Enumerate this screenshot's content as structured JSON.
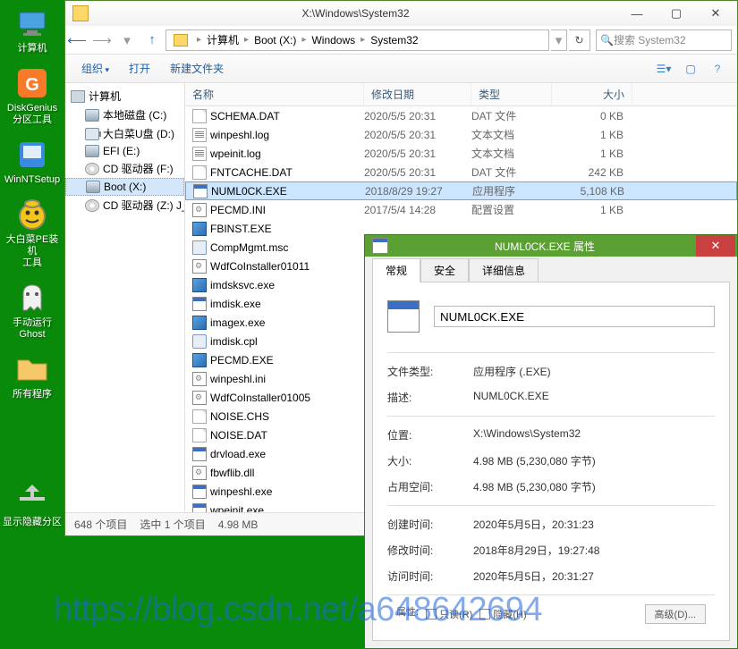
{
  "desktop": {
    "icons": [
      {
        "name": "computer",
        "label": "计算机",
        "color": "#4aa3e0"
      },
      {
        "name": "diskgenius",
        "label": "DiskGenius\n分区工具",
        "color": "#f77a2a"
      },
      {
        "name": "winntsetup",
        "label": "WinNTSetup",
        "color": "#3a8ae0"
      },
      {
        "name": "pe-tool",
        "label": "大白菜PE装机\n工具",
        "color": "#f5c51a"
      },
      {
        "name": "ghost",
        "label": "手动运行\nGhost",
        "color": "#e8e8e8"
      },
      {
        "name": "programs",
        "label": "所有程序",
        "color": "#f5c86a"
      },
      {
        "name": "hide-partition",
        "label": "显示隐藏分区",
        "color": "#888"
      }
    ]
  },
  "explorer": {
    "title": "X:\\Windows\\System32",
    "breadcrumbs": [
      "计算机",
      "Boot (X:)",
      "Windows",
      "System32"
    ],
    "search_placeholder": "搜索 System32",
    "commands": {
      "organize": "组织",
      "open": "打开",
      "new_folder": "新建文件夹"
    },
    "tree": [
      {
        "icon": "pc",
        "label": "计算机",
        "indent": 0
      },
      {
        "icon": "drive",
        "label": "本地磁盘 (C:)",
        "indent": 1
      },
      {
        "icon": "usb",
        "label": "大白菜U盘 (D:)",
        "indent": 1
      },
      {
        "icon": "drive",
        "label": "EFI (E:)",
        "indent": 1
      },
      {
        "icon": "cd",
        "label": "CD 驱动器 (F:)",
        "indent": 1
      },
      {
        "icon": "drive",
        "label": "Boot (X:)",
        "indent": 1,
        "sel": true
      },
      {
        "icon": "cd",
        "label": "CD 驱动器 (Z:) J_CC",
        "indent": 1
      }
    ],
    "columns": {
      "name": "名称",
      "date": "修改日期",
      "type": "类型",
      "size": "大小"
    },
    "files": [
      {
        "ico": "file",
        "name": "SCHEMA.DAT",
        "date": "2020/5/5 20:31",
        "type": "DAT 文件",
        "size": "0 KB"
      },
      {
        "ico": "txt",
        "name": "winpeshl.log",
        "date": "2020/5/5 20:31",
        "type": "文本文档",
        "size": "1 KB"
      },
      {
        "ico": "txt",
        "name": "wpeinit.log",
        "date": "2020/5/5 20:31",
        "type": "文本文档",
        "size": "1 KB"
      },
      {
        "ico": "file",
        "name": "FNTCACHE.DAT",
        "date": "2020/5/5 20:31",
        "type": "DAT 文件",
        "size": "242 KB"
      },
      {
        "ico": "exe",
        "name": "NUML0CK.EXE",
        "date": "2018/8/29 19:27",
        "type": "应用程序",
        "size": "5,108 KB",
        "sel": true
      },
      {
        "ico": "ini",
        "name": "PECMD.INI",
        "date": "2017/5/4 14:28",
        "type": "配置设置",
        "size": "1 KB"
      },
      {
        "ico": "exe-win",
        "name": "FBINST.EXE",
        "date": "",
        "type": "",
        "size": ""
      },
      {
        "ico": "msc",
        "name": "CompMgmt.msc",
        "date": "",
        "type": "",
        "size": ""
      },
      {
        "ico": "ini",
        "name": "WdfCoInstaller01011",
        "date": "",
        "type": "",
        "size": ""
      },
      {
        "ico": "exe-win",
        "name": "imdsksvc.exe",
        "date": "",
        "type": "",
        "size": ""
      },
      {
        "ico": "exe",
        "name": "imdisk.exe",
        "date": "",
        "type": "",
        "size": ""
      },
      {
        "ico": "exe-win",
        "name": "imagex.exe",
        "date": "",
        "type": "",
        "size": ""
      },
      {
        "ico": "cpl",
        "name": "imdisk.cpl",
        "date": "",
        "type": "",
        "size": ""
      },
      {
        "ico": "exe-win",
        "name": "PECMD.EXE",
        "date": "",
        "type": "",
        "size": ""
      },
      {
        "ico": "ini",
        "name": "winpeshl.ini",
        "date": "",
        "type": "",
        "size": ""
      },
      {
        "ico": "ini",
        "name": "WdfCoInstaller01005",
        "date": "",
        "type": "",
        "size": ""
      },
      {
        "ico": "file",
        "name": "NOISE.CHS",
        "date": "",
        "type": "",
        "size": ""
      },
      {
        "ico": "file",
        "name": "NOISE.DAT",
        "date": "",
        "type": "",
        "size": ""
      },
      {
        "ico": "exe",
        "name": "drvload.exe",
        "date": "",
        "type": "",
        "size": ""
      },
      {
        "ico": "dll",
        "name": "fbwflib.dll",
        "date": "",
        "type": "",
        "size": ""
      },
      {
        "ico": "exe",
        "name": "winpeshl.exe",
        "date": "",
        "type": "",
        "size": ""
      },
      {
        "ico": "exe",
        "name": "wpeinit.exe",
        "date": "",
        "type": "",
        "size": ""
      }
    ],
    "status": {
      "count": "648 个项目",
      "selected": "选中 1 个项目",
      "size": "4.98 MB"
    }
  },
  "properties": {
    "title": "NUML0CK.EXE 属性",
    "tabs": {
      "general": "常规",
      "security": "安全",
      "details": "详细信息"
    },
    "filename": "NUML0CK.EXE",
    "rows": [
      {
        "k": "文件类型:",
        "v": "应用程序 (.EXE)"
      },
      {
        "k": "描述:",
        "v": "NUML0CK.EXE"
      }
    ],
    "rows2": [
      {
        "k": "位置:",
        "v": "X:\\Windows\\System32"
      },
      {
        "k": "大小:",
        "v": "4.98 MB (5,230,080 字节)"
      },
      {
        "k": "占用空间:",
        "v": "4.98 MB (5,230,080 字节)"
      }
    ],
    "rows3": [
      {
        "k": "创建时间:",
        "v": "2020年5月5日，20:31:23"
      },
      {
        "k": "修改时间:",
        "v": "2018年8月29日，19:27:48"
      },
      {
        "k": "访问时间:",
        "v": "2020年5月5日，20:31:27"
      }
    ],
    "bottom": {
      "attrs": "属性:",
      "readonly": "只读(R)",
      "hidden": "隐藏(H)",
      "advanced": "高级(D)..."
    }
  },
  "watermark": "https://blog.csdn.net/a648642694"
}
